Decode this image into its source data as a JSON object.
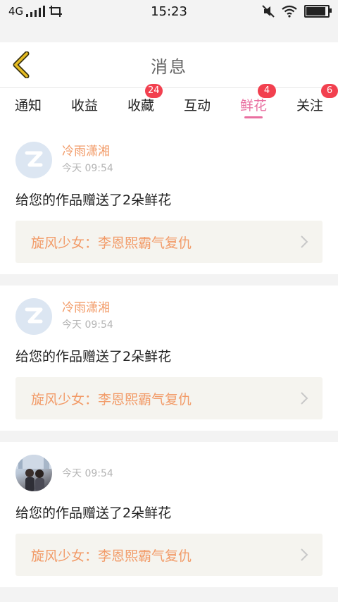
{
  "status_bar": {
    "network": "4G",
    "time": "15:23",
    "battery_level": 0.9
  },
  "header": {
    "title": "消息",
    "back_icon": "chevron-left-icon"
  },
  "tabs": [
    {
      "label": "通知"
    },
    {
      "label": "收益"
    },
    {
      "label": "收藏",
      "badge": "24"
    },
    {
      "label": "互动"
    },
    {
      "label": "鲜花",
      "badge": "4",
      "active": true
    },
    {
      "label": "关注",
      "badge": "6"
    }
  ],
  "colors": {
    "accent": "#e96fa0",
    "name": "#f29b68",
    "badge": "#f2404f",
    "link_bg": "#f5f4ef"
  },
  "messages": [
    {
      "user": "冷雨潇湘",
      "time": "今天 09:54",
      "text": "给您的作品赠送了2朵鲜花",
      "work": "旋风少女：李恩熙霸气复仇",
      "avatar": "default-avatar-icon"
    },
    {
      "user": "冷雨潇湘",
      "time": "今天 09:54",
      "text": "给您的作品赠送了2朵鲜花",
      "work": "旋风少女：李恩熙霸气复仇",
      "avatar": "default-avatar-icon"
    },
    {
      "user": "",
      "time": "今天 09:54",
      "text": "给您的作品赠送了2朵鲜花",
      "work": "旋风少女：李恩熙霸气复仇",
      "avatar": "photo-avatar"
    }
  ]
}
